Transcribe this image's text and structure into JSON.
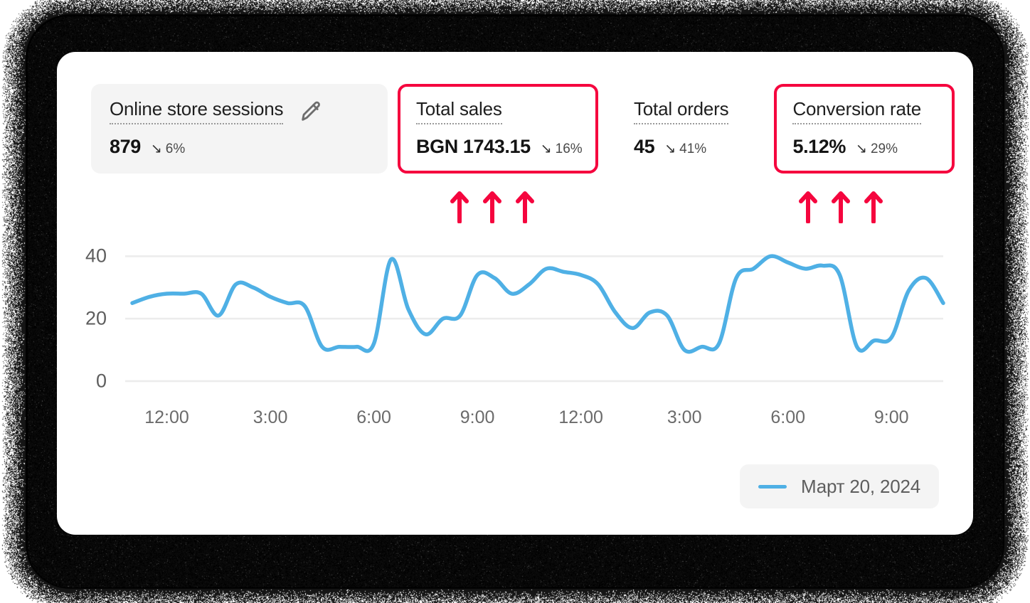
{
  "theme": {
    "accent_red": "#f5053e",
    "line_blue": "#4fb0e5",
    "card_gray": "#f4f4f4",
    "grid_gray": "#ececec",
    "frame_dark": "#050505"
  },
  "metrics": [
    {
      "label": "Online store sessions",
      "value": "879",
      "delta": "6%",
      "delta_arrow": "↘",
      "delta_direction": "down",
      "style": "shaded",
      "has_edit_icon": true,
      "edit_icon": "pencil-icon"
    },
    {
      "label": "Total sales",
      "value": "BGN 1743.15",
      "delta": "16%",
      "delta_arrow": "↘",
      "delta_direction": "down",
      "style": "highlight",
      "has_edit_icon": false
    },
    {
      "label": "Total orders",
      "value": "45",
      "delta": "41%",
      "delta_arrow": "↘",
      "delta_direction": "down",
      "style": "plain",
      "has_edit_icon": false
    },
    {
      "label": "Conversion rate",
      "value": "5.12%",
      "delta": "29%",
      "delta_arrow": "↘",
      "delta_direction": "down",
      "style": "highlight",
      "has_edit_icon": false
    }
  ],
  "annotations": [
    {
      "icon": "up-arrow-icon",
      "count": 3,
      "color": "#f5053e",
      "points_at": "Total sales"
    },
    {
      "icon": "up-arrow-icon",
      "count": 3,
      "color": "#f5053e",
      "points_at": "Conversion rate"
    }
  ],
  "legend": {
    "label": "Март 20, 2024",
    "swatch_color": "#4fb0e5"
  },
  "chart_data": {
    "type": "line",
    "title": "",
    "xlabel": "",
    "ylabel": "",
    "ylim": [
      0,
      46
    ],
    "yticks": [
      0,
      20,
      40
    ],
    "ytick_labels": [
      "0",
      "20",
      "40"
    ],
    "grid": true,
    "grid_axis": "y",
    "legend_position": "bottom-right",
    "series": [
      {
        "name": "Март 20, 2024",
        "color": "#4fb0e5",
        "x": [
          0,
          1,
          2,
          3,
          4,
          5,
          6,
          7,
          8,
          9,
          10,
          11,
          12,
          13,
          14,
          15,
          16,
          17,
          18,
          19,
          20,
          21,
          22,
          23,
          24,
          25,
          26,
          27,
          28,
          29,
          30,
          31,
          32,
          33,
          34,
          35,
          36,
          37,
          38,
          39,
          40,
          41,
          42,
          43,
          44,
          45,
          46,
          47
        ],
        "values": [
          25,
          27,
          28,
          28,
          28,
          21,
          31,
          30,
          27,
          25,
          24,
          11,
          11,
          11,
          12,
          39,
          23,
          15,
          20,
          21,
          34,
          33,
          28,
          31,
          36,
          35,
          34,
          31,
          22,
          17,
          22,
          21,
          10,
          11,
          12,
          33,
          36,
          40,
          38,
          36,
          37,
          34,
          11,
          13,
          14,
          29,
          33,
          25
        ]
      }
    ],
    "xticks": [
      2,
      8,
      14,
      20,
      26,
      32,
      38,
      44
    ],
    "xtick_labels": [
      "12:00",
      "3:00",
      "6:00",
      "9:00",
      "12:00",
      "3:00",
      "6:00",
      "9:00"
    ]
  }
}
